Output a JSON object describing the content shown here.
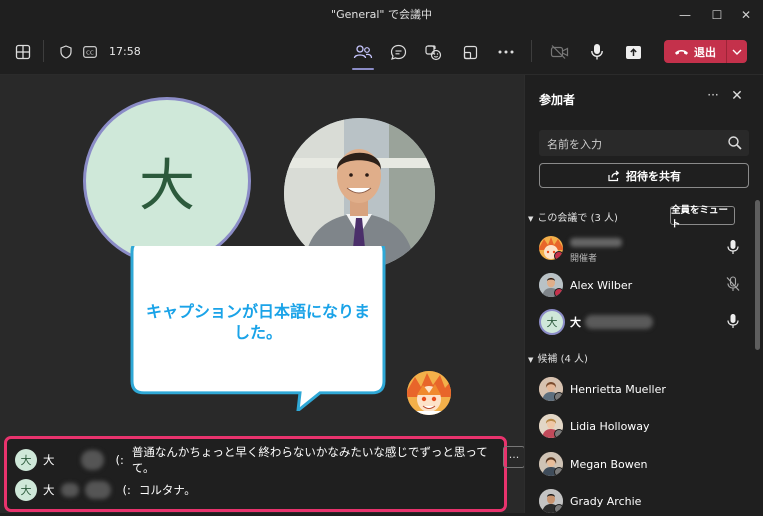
{
  "window": {
    "title": "\"General\" で会議中",
    "minimize_glyph": "—",
    "maximize_glyph": "☐",
    "close_glyph": "✕"
  },
  "toolbar": {
    "timer": "17:58",
    "leave_label": "退出",
    "icons": [
      "grid-icon",
      "shield-icon",
      "cc-icon",
      "people-icon",
      "chat-icon",
      "reactions-icon",
      "rooms-icon",
      "more-icon",
      "camera-off-icon",
      "mic-icon",
      "share-screen-icon",
      "phone-icon",
      "chevron-down-icon"
    ]
  },
  "stage": {
    "main_avatar_initial": "大",
    "callout_text": "キャプションが日本語になりました。",
    "colors": {
      "callout_border": "#2fa8d6",
      "callout_text": "#1aa3e8",
      "caption_border": "#e8336d",
      "active_ring": "#8b8cc7"
    }
  },
  "captions": {
    "rows": [
      {
        "initial": "大",
        "name": "大",
        "text": "普通なんかちょっと早く終わらないかなみたいな感じでずっと思ってて。"
      },
      {
        "initial": "大",
        "name": "大",
        "text": "コルタナ。"
      }
    ],
    "separator": "(:",
    "more_label": "···"
  },
  "panel": {
    "title": "参加者",
    "more_label": "···",
    "close_label": "✕",
    "search_placeholder": "名前を入力",
    "share_label": "招待を共有",
    "in_meeting_label": "この会議で (3 人)",
    "mute_all_label": "全員をミュート",
    "in_meeting": [
      {
        "name": "",
        "role": "開催者",
        "mic": "on"
      },
      {
        "name": "Alex Wilber",
        "role": "",
        "mic": "off"
      },
      {
        "name": "大",
        "role": "",
        "mic": "on",
        "initial": "大"
      }
    ],
    "suggested_label": "候補 (4 人)",
    "suggested": [
      {
        "name": "Henrietta Mueller"
      },
      {
        "name": "Lidia Holloway"
      },
      {
        "name": "Megan Bowen"
      },
      {
        "name": "Grady Archie"
      }
    ]
  }
}
